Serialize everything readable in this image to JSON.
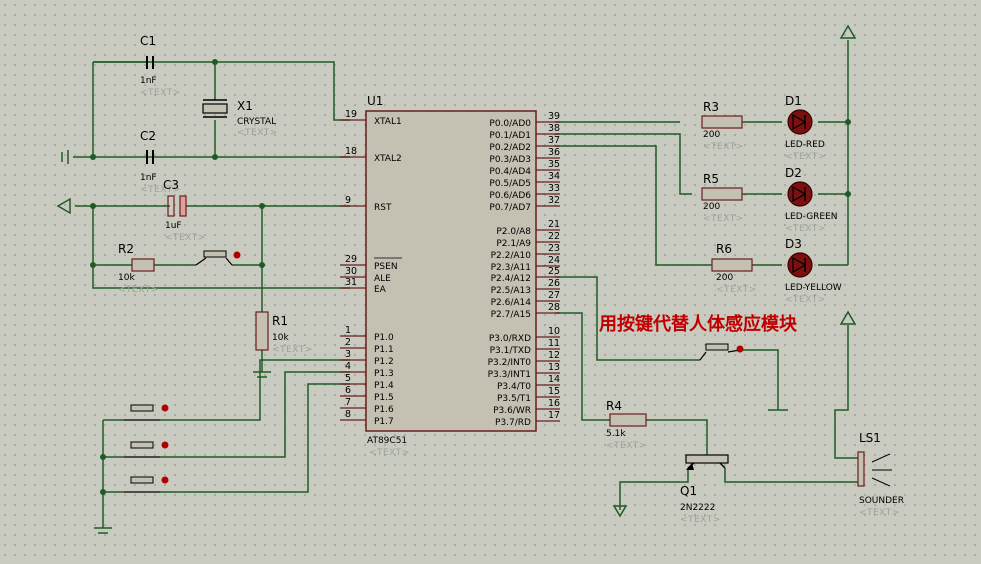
{
  "chip": {
    "ref": "U1",
    "model": "AT89C51",
    "placeholder": "<TEXT>",
    "left_pins": [
      {
        "num": "19",
        "name": "XTAL1"
      },
      {
        "num": "18",
        "name": "XTAL2"
      },
      {
        "num": "9",
        "name": "RST"
      },
      {
        "num": "29",
        "name": "PSEN"
      },
      {
        "num": "30",
        "name": "ALE"
      },
      {
        "num": "31",
        "name": "EA"
      },
      {
        "num": "1",
        "name": "P1.0"
      },
      {
        "num": "2",
        "name": "P1.1"
      },
      {
        "num": "3",
        "name": "P1.2"
      },
      {
        "num": "4",
        "name": "P1.3"
      },
      {
        "num": "5",
        "name": "P1.4"
      },
      {
        "num": "6",
        "name": "P1.5"
      },
      {
        "num": "7",
        "name": "P1.6"
      },
      {
        "num": "8",
        "name": "P1.7"
      }
    ],
    "right_pins": [
      {
        "num": "39",
        "name": "P0.0/AD0"
      },
      {
        "num": "38",
        "name": "P0.1/AD1"
      },
      {
        "num": "37",
        "name": "P0.2/AD2"
      },
      {
        "num": "36",
        "name": "P0.3/AD3"
      },
      {
        "num": "35",
        "name": "P0.4/AD4"
      },
      {
        "num": "34",
        "name": "P0.5/AD5"
      },
      {
        "num": "33",
        "name": "P0.6/AD6"
      },
      {
        "num": "32",
        "name": "P0.7/AD7"
      },
      {
        "num": "21",
        "name": "P2.0/A8"
      },
      {
        "num": "22",
        "name": "P2.1/A9"
      },
      {
        "num": "23",
        "name": "P2.2/A10"
      },
      {
        "num": "24",
        "name": "P2.3/A11"
      },
      {
        "num": "25",
        "name": "P2.4/A12"
      },
      {
        "num": "26",
        "name": "P2.5/A13"
      },
      {
        "num": "27",
        "name": "P2.6/A14"
      },
      {
        "num": "28",
        "name": "P2.7/A15"
      },
      {
        "num": "10",
        "name": "P3.0/RXD"
      },
      {
        "num": "11",
        "name": "P3.1/TXD"
      },
      {
        "num": "12",
        "name": "P3.2/INT0"
      },
      {
        "num": "13",
        "name": "P3.3/INT1"
      },
      {
        "num": "14",
        "name": "P3.4/T0"
      },
      {
        "num": "15",
        "name": "P3.5/T1"
      },
      {
        "num": "16",
        "name": "P3.6/WR"
      },
      {
        "num": "17",
        "name": "P3.7/RD"
      }
    ]
  },
  "components": {
    "c1": {
      "ref": "C1",
      "value": "1nF",
      "text": "<TEXT>"
    },
    "c2": {
      "ref": "C2",
      "value": "1nF",
      "text": "<TEXT>"
    },
    "c3": {
      "ref": "C3",
      "value": "1uF",
      "text": "<TEXT>"
    },
    "x1": {
      "ref": "X1",
      "value": "CRYSTAL",
      "text": "<TEXT>"
    },
    "r1": {
      "ref": "R1",
      "value": "10k",
      "text": "<TEXT>"
    },
    "r2": {
      "ref": "R2",
      "value": "10k",
      "text": "<TEXT>"
    },
    "r3": {
      "ref": "R3",
      "value": "200",
      "text": "<TEXT>"
    },
    "r4": {
      "ref": "R4",
      "value": "5.1k",
      "text": "<TEXT>"
    },
    "r5": {
      "ref": "R5",
      "value": "200",
      "text": "<TEXT>"
    },
    "r6": {
      "ref": "R6",
      "value": "200",
      "text": "<TEXT>"
    },
    "d1": {
      "ref": "D1",
      "value": "LED-RED",
      "text": "<TEXT>"
    },
    "d2": {
      "ref": "D2",
      "value": "LED-GREEN",
      "text": "<TEXT>"
    },
    "d3": {
      "ref": "D3",
      "value": "LED-YELLOW",
      "text": "<TEXT>"
    },
    "q1": {
      "ref": "Q1",
      "value": "2N2222",
      "text": "<TEXT>"
    },
    "ls1": {
      "ref": "LS1",
      "value": "SOUNDER",
      "text": "<TEXT>"
    }
  },
  "annotation": "用按键代替人体感应模块",
  "colors": {
    "wire": "#1f5b24",
    "background": "#c9cbc0",
    "annotation": "#c00000",
    "component": "#6b1c1c"
  }
}
